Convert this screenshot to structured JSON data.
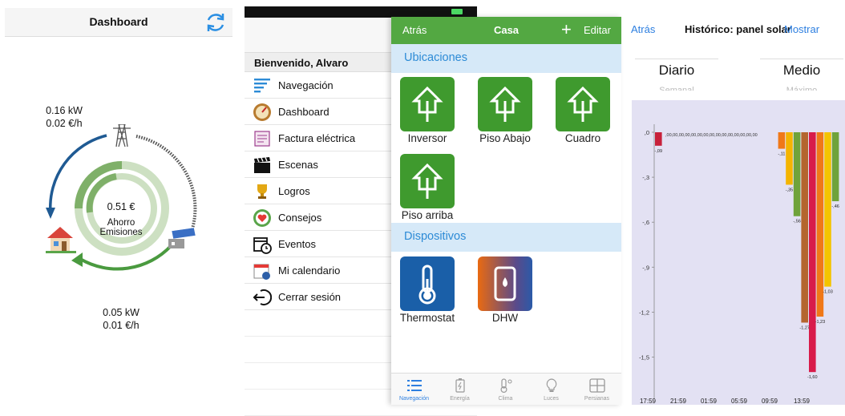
{
  "dashboard": {
    "title": "Dashboard",
    "grid_power": "0.16 kW",
    "grid_cost": "0.02 €/h",
    "center_value": "0.51 €",
    "center_line1": "Ahorro",
    "center_line2": "Emisiones",
    "solar_power": "0.05 kW",
    "solar_cost": "0.01 €/h",
    "colors": {
      "blue_arc": "#1f5a93",
      "green_arc": "#4a9a3f",
      "ring_dark": "#7fb069",
      "ring_light": "#cde0c2"
    }
  },
  "menu": {
    "welcome": "Bienvenido, Alvaro",
    "items": [
      {
        "label": "Navegación",
        "icon": "list-icon"
      },
      {
        "label": "Dashboard",
        "icon": "gauge-icon"
      },
      {
        "label": "Factura eléctrica",
        "icon": "invoice-icon"
      },
      {
        "label": "Escenas",
        "icon": "clapperboard-icon"
      },
      {
        "label": "Logros",
        "icon": "trophy-icon"
      },
      {
        "label": "Consejos",
        "icon": "heart-icon"
      },
      {
        "label": "Eventos",
        "icon": "calendar-clock-icon"
      },
      {
        "label": "Mi calendario",
        "icon": "calendar-icon"
      },
      {
        "label": "Cerrar sesión",
        "icon": "logout-icon"
      }
    ]
  },
  "casa": {
    "back": "Atrás",
    "title": "Casa",
    "plus": "+",
    "edit": "Editar",
    "section_locations": "Ubicaciones",
    "locations": [
      "Inversor",
      "Piso Abajo",
      "Cuadro",
      "Piso arriba"
    ],
    "section_devices": "Dispositivos",
    "devices": [
      "Thermostat",
      "DHW"
    ],
    "tabs": [
      "Navegación",
      "Energía",
      "Clima",
      "Luces",
      "Persianas"
    ],
    "colors": {
      "nav_green": "#53a842",
      "tile_green": "#3f9a2e",
      "section_bg": "#d6e9f8",
      "section_text": "#2d8bd6"
    }
  },
  "historico": {
    "back": "Atrás",
    "title": "Histórico: panel solar",
    "show": "Mostrar",
    "seg_left": "Diario",
    "seg_left_under": "Semanal",
    "seg_right": "Medio",
    "seg_right_under": "Máximo"
  },
  "chart_data": {
    "type": "bar",
    "y_ticks": [
      ",0",
      "-,3",
      "-,6",
      "-,9",
      "-1,2",
      "-1,5"
    ],
    "x_ticks": [
      "17:59",
      "21:59",
      "01:59",
      "05:59",
      "09:59",
      "13:59"
    ],
    "ylim": [
      -1.7,
      0.05
    ],
    "zero_labels": ",00,00,00,00,00,00,00,00,00,00,00,00,00,00,00",
    "series": [
      {
        "x": "17:59",
        "value": -0.09,
        "label": "-,09",
        "color": "#c8213b"
      },
      {
        "x": "09:59",
        "value": -0.11,
        "label": "-,11",
        "color": "#f07818"
      },
      {
        "x": "10:59",
        "value": -0.35,
        "label": "-,35",
        "color": "#f4b400"
      },
      {
        "x": "11:59",
        "value": -0.56,
        "label": "-,56",
        "color": "#6fa33a"
      },
      {
        "x": "12:59",
        "value": -1.27,
        "label": "-1,27",
        "color": "#b4652e"
      },
      {
        "x": "13:59",
        "value": -1.6,
        "label": "-1,60",
        "color": "#d81b4a"
      },
      {
        "x": "14:59",
        "value": -1.23,
        "label": "-1,23",
        "color": "#f07818"
      },
      {
        "x": "15:59",
        "value": -1.03,
        "label": "-1,03",
        "color": "#f4c400"
      },
      {
        "x": "16:59",
        "value": -0.46,
        "label": "-,46",
        "color": "#6fa33a"
      }
    ]
  }
}
